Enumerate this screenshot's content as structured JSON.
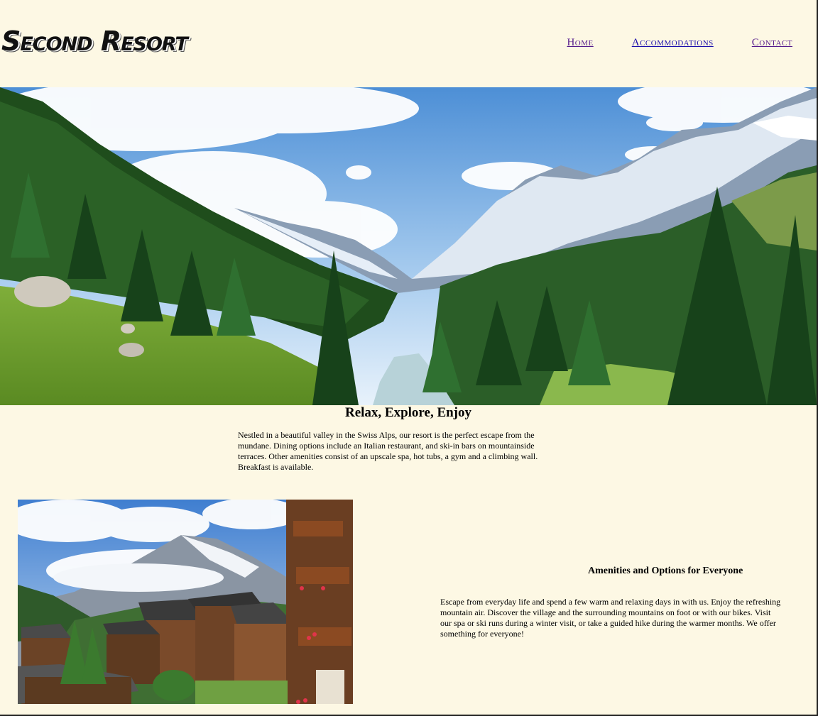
{
  "header": {
    "logo": "Second Resort",
    "nav": [
      {
        "label": "Home"
      },
      {
        "label": "Accommodations"
      },
      {
        "label": "Contact"
      }
    ]
  },
  "hero": {
    "description_icon": "mountain-valley-image"
  },
  "intro": {
    "title": "Relax, Explore, Enjoy",
    "text": "Nestled in a beautiful valley in the Swiss Alps, our resort is the perfect escape from the mundane. Dining options include an Italian restaurant, and ski-in bars on mountainside terraces. Other amenities consist of an upscale spa, hot tubs, a gym and a climbing wall. Breakfast is available."
  },
  "amenities": {
    "title": "Amenities and Options for Everyone",
    "text": "Escape from everyday life and spend a few warm and relaxing days in with us. Enjoy the refreshing mountain air. Discover the village and the surrounding mountains on foot or with our bikes. Visit our spa or ski runs during a winter visit, or take a guided hike during the warmer months. We offer something for everyone!"
  },
  "colors": {
    "background": "#fdf8e4",
    "visited_link": "#551a8b",
    "link": "#1a0dab"
  }
}
